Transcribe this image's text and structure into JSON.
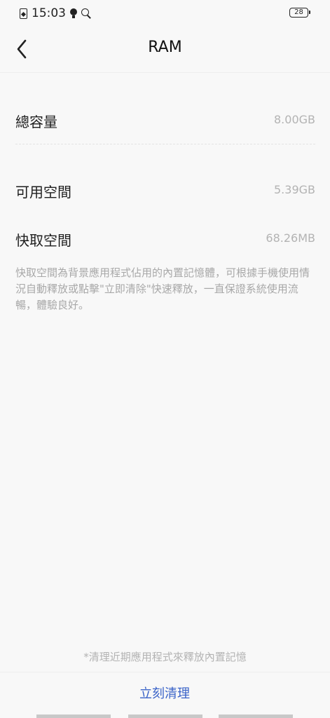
{
  "status_bar": {
    "time": "15:03",
    "battery": "28"
  },
  "header": {
    "title": "RAM"
  },
  "memory": {
    "total_label": "總容量",
    "total_value": "8.00GB",
    "available_label": "可用空間",
    "available_value": "5.39GB",
    "cache_label": "快取空間",
    "cache_value": "68.26MB",
    "description": "快取空間為背景應用程式佔用的內置記憶體，可根據手機使用情況自動釋放或點擊\"立即清除\"快速釋放，一直保證系統使用流暢，體驗良好。"
  },
  "footer": {
    "note": "*清理近期應用程式來釋放內置記憶",
    "clean_button": "立刻清理"
  },
  "colors": {
    "accent": "#3a63c8",
    "background": "#f8f8f8",
    "secondary_text": "#b3b3b3"
  }
}
